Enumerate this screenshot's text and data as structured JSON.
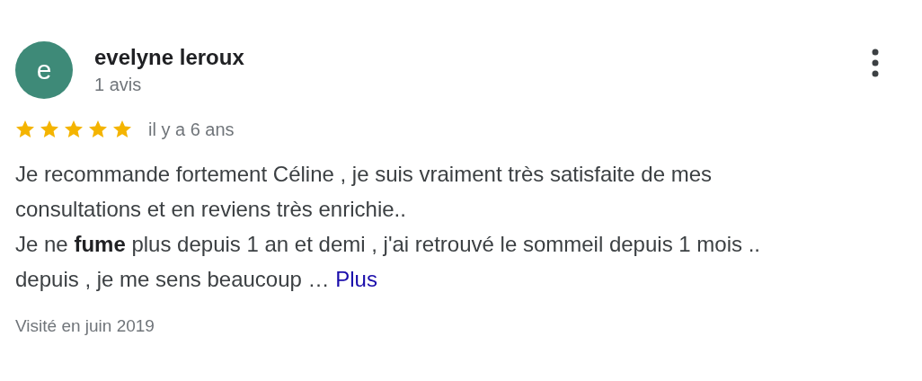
{
  "review": {
    "author": {
      "initial": "e",
      "name": "evelyne leroux",
      "review_count": "1 avis"
    },
    "stars": 5,
    "time": "il y a 6 ans",
    "text": "Je recommande fortement Céline , je suis vraiment très satisfaite de mes\nconsultations et en reviens très enrichie..\nJe ne **fume** plus depuis 1 an et demi , j'ai retrouvé le sommeil depuis 1 mois ..\ndepuis , je me sens beaucoup … ",
    "more_link": "Plus",
    "visited": "Visité en juin 2019"
  }
}
